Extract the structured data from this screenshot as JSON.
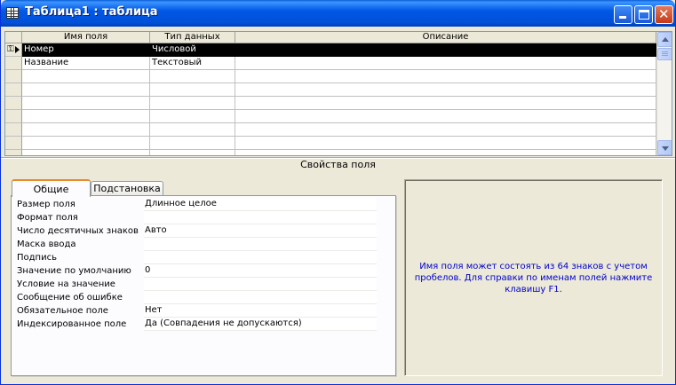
{
  "window": {
    "title": "Таблица1 : таблица",
    "icon": "table-icon"
  },
  "grid": {
    "columns": [
      "Имя поля",
      "Тип данных",
      "Описание"
    ],
    "rows": [
      {
        "name": "Номер",
        "type": "Числовой",
        "desc": "",
        "primary_key": true,
        "selected": true
      },
      {
        "name": "Название",
        "type": "Текстовый",
        "desc": "",
        "primary_key": false,
        "selected": false
      },
      {
        "name": "",
        "type": "",
        "desc": ""
      },
      {
        "name": "",
        "type": "",
        "desc": ""
      },
      {
        "name": "",
        "type": "",
        "desc": ""
      },
      {
        "name": "",
        "type": "",
        "desc": ""
      },
      {
        "name": "",
        "type": "",
        "desc": ""
      },
      {
        "name": "",
        "type": "",
        "desc": ""
      },
      {
        "name": "",
        "type": "",
        "desc": ""
      }
    ]
  },
  "properties": {
    "section_title": "Свойства поля",
    "tabs": [
      {
        "label": "Общие",
        "active": true
      },
      {
        "label": "Подстановка",
        "active": false
      }
    ],
    "rows": [
      {
        "label": "Размер поля",
        "value": "Длинное целое"
      },
      {
        "label": "Формат поля",
        "value": ""
      },
      {
        "label": "Число десятичных знаков",
        "value": "Авто"
      },
      {
        "label": "Маска ввода",
        "value": ""
      },
      {
        "label": "Подпись",
        "value": ""
      },
      {
        "label": "Значение по умолчанию",
        "value": "0"
      },
      {
        "label": "Условие на значение",
        "value": ""
      },
      {
        "label": "Сообщение об ошибке",
        "value": ""
      },
      {
        "label": "Обязательное поле",
        "value": "Нет"
      },
      {
        "label": "Индексированное поле",
        "value": "Да (Совпадения не допускаются)"
      }
    ],
    "help_text": "Имя поля может состоять из 64 знаков с учетом пробелов.  Для справки по именам полей нажмите клавишу F1."
  },
  "colors": {
    "titlebar": "#0058e6",
    "selection": "#000000",
    "help_text": "#0000cc",
    "active_tab_accent": "#e68b2c"
  }
}
